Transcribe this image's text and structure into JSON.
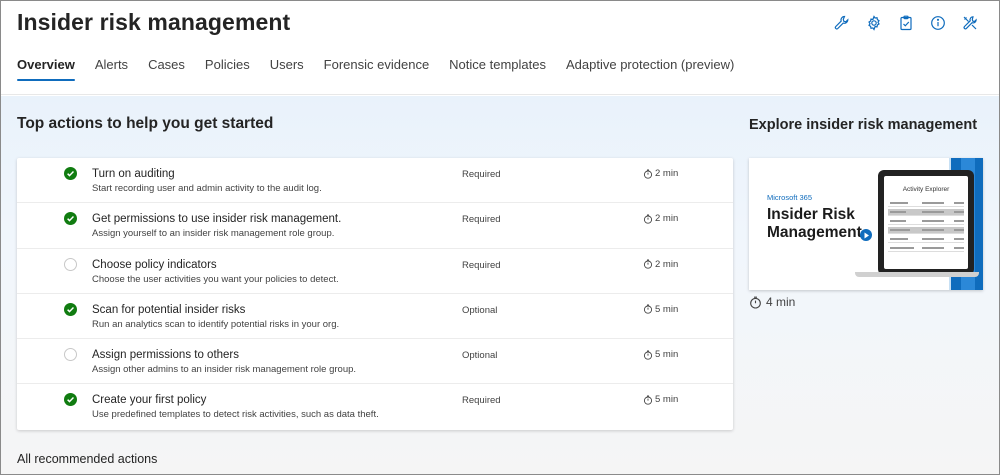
{
  "header": {
    "title": "Insider risk management",
    "icons": [
      "wrench-icon",
      "gear-icon",
      "clipboard-icon",
      "info-icon",
      "tools-icon"
    ]
  },
  "tabs": [
    {
      "label": "Overview",
      "active": true
    },
    {
      "label": "Alerts",
      "active": false
    },
    {
      "label": "Cases",
      "active": false
    },
    {
      "label": "Policies",
      "active": false
    },
    {
      "label": "Users",
      "active": false
    },
    {
      "label": "Forensic evidence",
      "active": false
    },
    {
      "label": "Notice templates",
      "active": false
    },
    {
      "label": "Adaptive protection (preview)",
      "active": false
    }
  ],
  "actions": {
    "title": "Top actions to help you get started",
    "items": [
      {
        "title": "Turn on auditing",
        "desc": "Start recording user and admin activity to the audit log.",
        "requirement": "Required",
        "time": "2 min",
        "done": true
      },
      {
        "title": "Get permissions to use insider risk management.",
        "desc": "Assign yourself to an insider risk management role group.",
        "requirement": "Required",
        "time": "2 min",
        "done": true
      },
      {
        "title": "Choose policy indicators",
        "desc": "Choose the user activities you want your policies to detect.",
        "requirement": "Required",
        "time": "2 min",
        "done": false
      },
      {
        "title": "Scan for potential insider risks",
        "desc": "Run an analytics scan to identify potential risks in your org.",
        "requirement": "Optional",
        "time": "5 min",
        "done": true
      },
      {
        "title": "Assign permissions to others",
        "desc": "Assign other admins to an insider risk management role group.",
        "requirement": "Optional",
        "time": "5 min",
        "done": false
      },
      {
        "title": "Create your first policy",
        "desc": "Use predefined templates to detect risk activities, such as data theft.",
        "requirement": "Required",
        "time": "5 min",
        "done": true
      }
    ],
    "all_link": "All recommended actions"
  },
  "explore": {
    "title": "Explore insider risk management",
    "video": {
      "brand": "Microsoft 365",
      "title": "Insider Risk Management",
      "screen_title": "Activity Explorer",
      "duration": "4 min"
    }
  },
  "colors": {
    "accent": "#0f6cbd",
    "success": "#107c10"
  }
}
